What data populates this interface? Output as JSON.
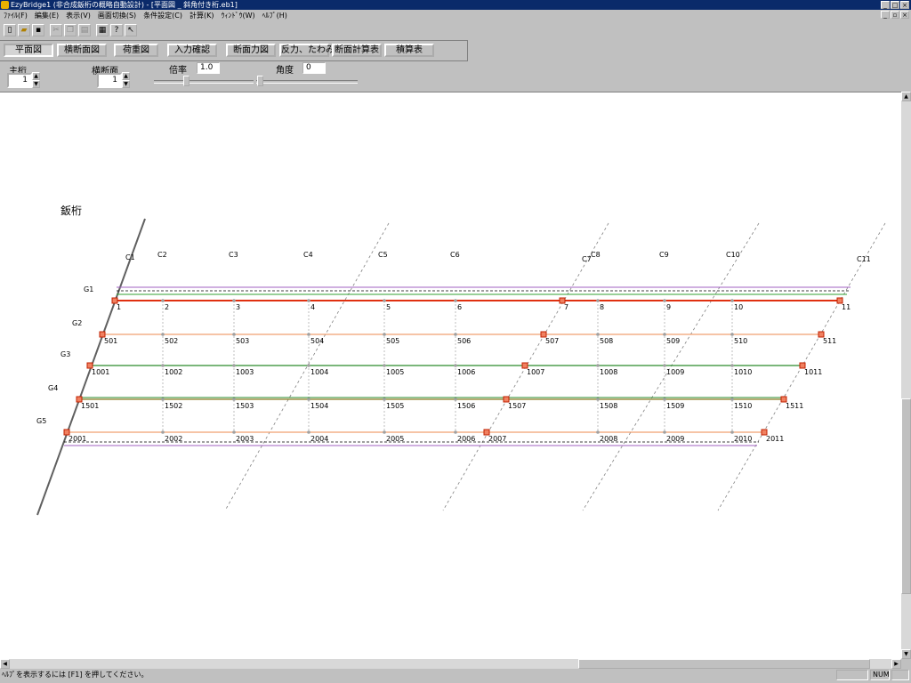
{
  "window": {
    "title": "EzyBridge1 (非合成鈑桁の概略自動設計) - [平面図 _ 斜角付き桁.eb1]"
  },
  "menu": [
    "ﾌｧｲﾙ(F)",
    "編集(E)",
    "表示(V)",
    "画面切換(S)",
    "条件設定(C)",
    "計算(K)",
    "ｳｨﾝﾄﾞｳ(W)",
    "ﾍﾙﾌﾟ(H)"
  ],
  "toolbar": {
    "icons": [
      "new-file-icon",
      "open-folder-icon",
      "save-icon",
      "cut-icon",
      "copy-icon",
      "paste-icon",
      "print-icon",
      "help-icon",
      "context-help-icon"
    ]
  },
  "views": {
    "buttons": [
      "平面図",
      "横断面図",
      "荷重図",
      "入力確認",
      "断面力図",
      "反力、たわみ",
      "断面計算表",
      "積算表"
    ],
    "active": "平面図"
  },
  "controls": {
    "main_girder_label": "主桁",
    "main_girder_value": "1",
    "cross_section_label": "横断面",
    "cross_section_value": "1",
    "scale_label": "倍率",
    "scale_value": "1.0",
    "angle_label": "角度",
    "angle_value": "0"
  },
  "drawing": {
    "title": "鈑桁",
    "columns": [
      "C1",
      "C2",
      "C3",
      "C4",
      "C5",
      "C6",
      "C7",
      "C8",
      "C9",
      "C10",
      "C11"
    ],
    "girders": [
      {
        "name": "G1",
        "color": "#e03010",
        "nodes": [
          "1",
          "2",
          "3",
          "4",
          "5",
          "6",
          "7",
          "8",
          "9",
          "10",
          "11"
        ]
      },
      {
        "name": "G2",
        "color": "#f0a070",
        "nodes": [
          "501",
          "502",
          "503",
          "504",
          "505",
          "506",
          "507",
          "508",
          "509",
          "510",
          "511"
        ]
      },
      {
        "name": "G3",
        "color": "#2a8a2a",
        "nodes": [
          "1001",
          "1002",
          "1003",
          "1004",
          "1005",
          "1006",
          "1007",
          "1008",
          "1009",
          "1010",
          "1011"
        ]
      },
      {
        "name": "G4",
        "color": "#8a7a20",
        "nodes": [
          "1501",
          "1502",
          "1503",
          "1504",
          "1505",
          "1506",
          "1507",
          "1508",
          "1509",
          "1510",
          "1511"
        ]
      },
      {
        "name": "G5",
        "color": "#f0a070",
        "nodes": [
          "2001",
          "2002",
          "2003",
          "2004",
          "2005",
          "2006",
          "2007",
          "2008",
          "2009",
          "2010",
          "2011"
        ]
      }
    ]
  },
  "status": {
    "message": "ﾍﾙﾌﾟを表示するには [F1] を押してください。",
    "num": "NUM"
  }
}
